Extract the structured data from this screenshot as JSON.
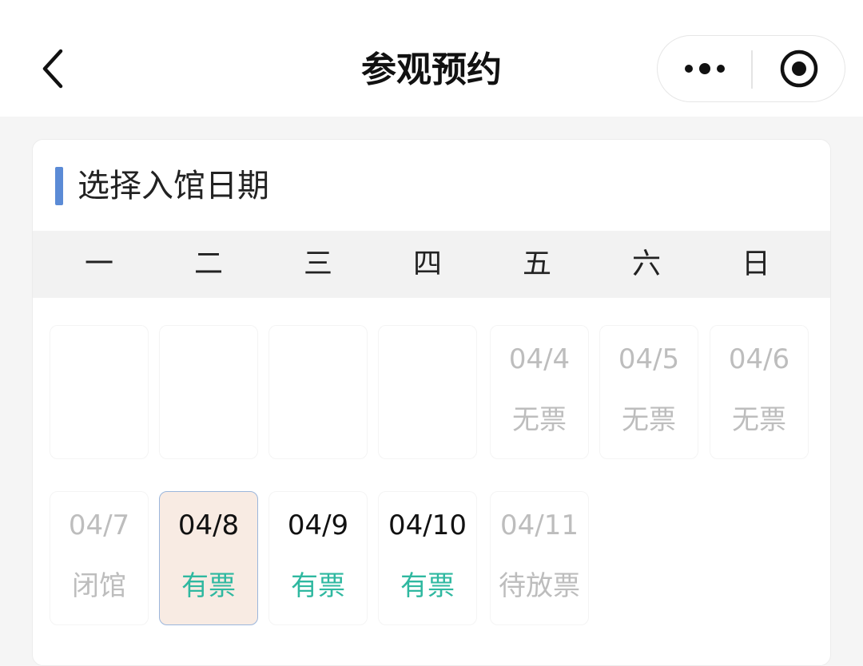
{
  "header": {
    "title": "参观预约"
  },
  "section": {
    "title": "选择入馆日期"
  },
  "colors": {
    "accent_bar": "#5b8bd6",
    "available": "#2fb8a0",
    "unavailable": "#bdbdbd",
    "active_date": "#111111",
    "selected_bg": "#f8ebe3",
    "selected_border": "#9bb6dc"
  },
  "weekdays": [
    "一",
    "二",
    "三",
    "四",
    "五",
    "六",
    "日"
  ],
  "weeks": [
    [
      {
        "date": "",
        "status": "",
        "state": "empty"
      },
      {
        "date": "",
        "status": "",
        "state": "empty"
      },
      {
        "date": "",
        "status": "",
        "state": "empty"
      },
      {
        "date": "",
        "status": "",
        "state": "empty"
      },
      {
        "date": "04/4",
        "status": "无票",
        "state": "disabled"
      },
      {
        "date": "04/5",
        "status": "无票",
        "state": "disabled"
      },
      {
        "date": "04/6",
        "status": "无票",
        "state": "disabled"
      }
    ],
    [
      {
        "date": "04/7",
        "status": "闭馆",
        "state": "disabled"
      },
      {
        "date": "04/8",
        "status": "有票",
        "state": "selected"
      },
      {
        "date": "04/9",
        "status": "有票",
        "state": "available"
      },
      {
        "date": "04/10",
        "status": "有票",
        "state": "available"
      },
      {
        "date": "04/11",
        "status": "待放票",
        "state": "disabled"
      }
    ]
  ]
}
